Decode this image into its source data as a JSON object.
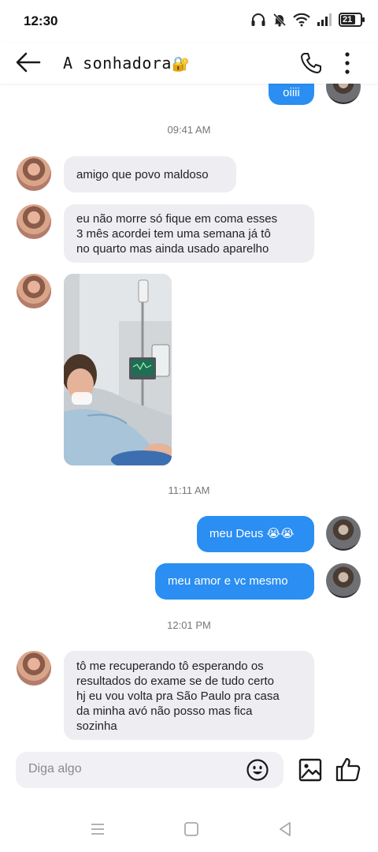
{
  "status_bar": {
    "time": "12:30",
    "battery": "21",
    "icons": [
      "headphones-icon",
      "mute-icon",
      "wifi-icon",
      "signal-icon",
      "battery-icon"
    ]
  },
  "header": {
    "title": "A sonhadora",
    "title_emoji": "🔐"
  },
  "messages": [
    {
      "side": "out",
      "text": "oiiii"
    },
    {
      "type": "timestamp",
      "text": "09:41 AM"
    },
    {
      "side": "in",
      "text": "amigo que povo maldoso"
    },
    {
      "side": "in",
      "lines": [
        "eu não morre só fique em coma esses",
        "3 mês acordei tem uma semana já tô",
        "no quarto mas ainda usado aparelho"
      ]
    },
    {
      "side": "in",
      "type": "image"
    },
    {
      "type": "timestamp",
      "text": "11:11 AM"
    },
    {
      "side": "out",
      "text": "meu Deus 😭😭"
    },
    {
      "side": "out",
      "text": "meu amor e vc mesmo"
    },
    {
      "type": "timestamp",
      "text": "12:01 PM"
    },
    {
      "side": "in",
      "lines": [
        "tô me recuperando tô esperando os",
        "resultados do exame se de tudo certo",
        "hj eu vou volta pra São Paulo pra casa",
        "da minha avó não posso mas fica",
        "sozinha"
      ]
    }
  ],
  "composer": {
    "placeholder": "Diga algo",
    "value": ""
  },
  "colors": {
    "outgoing_bubble": "#2a8ef2",
    "incoming_bubble": "#eeedf2",
    "timestamp": "#777777"
  }
}
